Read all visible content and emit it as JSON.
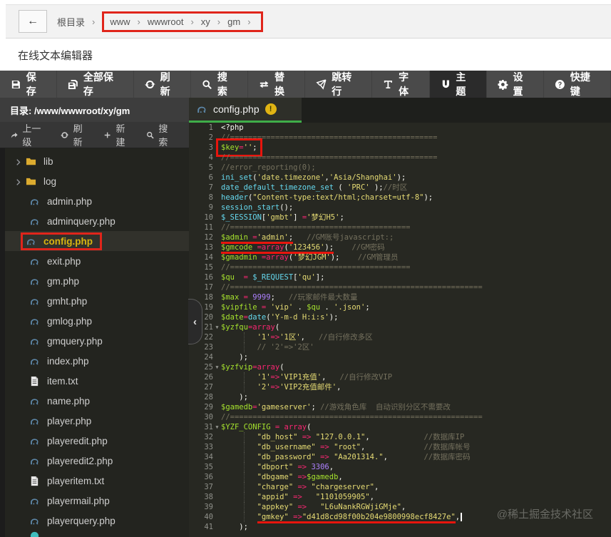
{
  "breadcrumb": {
    "back_glyph": "←",
    "root": "根目录",
    "separator": "›",
    "path": [
      "www",
      "wwwroot",
      "xy",
      "gm"
    ]
  },
  "page": {
    "title": "在线文本编辑器"
  },
  "toolbar": {
    "buttons": [
      {
        "name": "save",
        "icon": "save-icon",
        "label": "保存"
      },
      {
        "name": "save-all",
        "icon": "save-all-icon",
        "label": "全部保存"
      },
      {
        "name": "refresh",
        "icon": "refresh-icon",
        "label": "刷新"
      },
      {
        "name": "search",
        "icon": "search-icon",
        "label": "搜索"
      },
      {
        "name": "replace",
        "icon": "replace-icon",
        "label": "替换"
      },
      {
        "name": "goto-line",
        "icon": "goto-line-icon",
        "label": "跳转行"
      },
      {
        "name": "font",
        "icon": "font-icon",
        "label": "字体"
      },
      {
        "name": "theme",
        "icon": "theme-icon",
        "label": "主题",
        "active": true
      },
      {
        "name": "settings",
        "icon": "gear-icon",
        "label": "设置"
      },
      {
        "name": "hotkeys",
        "icon": "question-icon",
        "label": "快捷键"
      }
    ]
  },
  "sidebar": {
    "dir_label": "目录: /www/wwwroot/xy/gm",
    "actions": [
      {
        "name": "up-level",
        "icon": "up-icon",
        "label": "上一级"
      },
      {
        "name": "refresh",
        "icon": "refresh-icon",
        "label": "刷新"
      },
      {
        "name": "new-file",
        "icon": "plus-icon",
        "label": "新建"
      },
      {
        "name": "search",
        "icon": "search-icon",
        "label": "搜索"
      }
    ],
    "collapse_glyph": "‹",
    "tree": [
      {
        "type": "folder",
        "name": "lib"
      },
      {
        "type": "folder",
        "name": "log"
      },
      {
        "type": "php",
        "name": "admin.php"
      },
      {
        "type": "php",
        "name": "adminquery.php"
      },
      {
        "type": "php",
        "name": "config.php",
        "selected": true,
        "annotated": true
      },
      {
        "type": "php",
        "name": "exit.php"
      },
      {
        "type": "php",
        "name": "gm.php"
      },
      {
        "type": "php",
        "name": "gmht.php"
      },
      {
        "type": "php",
        "name": "gmlog.php"
      },
      {
        "type": "php",
        "name": "gmquery.php"
      },
      {
        "type": "php",
        "name": "index.php"
      },
      {
        "type": "txt",
        "name": "item.txt"
      },
      {
        "type": "php",
        "name": "name.php"
      },
      {
        "type": "php",
        "name": "player.php"
      },
      {
        "type": "php",
        "name": "playeredit.php"
      },
      {
        "type": "php",
        "name": "playeredit2.php"
      },
      {
        "type": "txt",
        "name": "playeritem.txt"
      },
      {
        "type": "php",
        "name": "playermail.php"
      },
      {
        "type": "php",
        "name": "playerquery.php"
      },
      {
        "type": "partial",
        "name": ""
      }
    ]
  },
  "editor": {
    "tab": {
      "icon": "php-icon",
      "label": "config.php",
      "warning_glyph": "!"
    },
    "lines": [
      {
        "tokens": [
          [
            "pl",
            "<?php"
          ]
        ]
      },
      {
        "tokens": [
          [
            "cm",
            "//=============================================="
          ]
        ]
      },
      {
        "box": [
          0,
          3
        ],
        "tokens": [
          [
            "var",
            "$key"
          ],
          [
            "kw",
            "="
          ],
          [
            "st",
            "''"
          ],
          [
            "pl",
            ";"
          ]
        ]
      },
      {
        "tokens": [
          [
            "cm",
            "//=============================================="
          ]
        ]
      },
      {
        "tokens": [
          [
            "cm",
            "//error_reporting(0);"
          ]
        ]
      },
      {
        "tokens": [
          [
            "fn",
            "ini_set"
          ],
          [
            "pl",
            "("
          ],
          [
            "st",
            "'date.timezone'"
          ],
          [
            "pl",
            ","
          ],
          [
            "st",
            "'Asia/Shanghai'"
          ],
          [
            "pl",
            ");"
          ]
        ]
      },
      {
        "tokens": [
          [
            "fn",
            "date_default_timezone_set"
          ],
          [
            "pl",
            " ( "
          ],
          [
            "st",
            "'PRC'"
          ],
          [
            "pl",
            " );"
          ],
          [
            "cm",
            "//时区"
          ]
        ]
      },
      {
        "tokens": [
          [
            "fn",
            "header"
          ],
          [
            "pl",
            "("
          ],
          [
            "st",
            "\"Content-type:text/html;charset=utf-8\""
          ],
          [
            "pl",
            ");"
          ]
        ]
      },
      {
        "tokens": [
          [
            "fn",
            "session_start"
          ],
          [
            "pl",
            "();"
          ]
        ]
      },
      {
        "tokens": [
          [
            "fn",
            "$_SESSION"
          ],
          [
            "pl",
            "["
          ],
          [
            "st",
            "'gmbt'"
          ],
          [
            "pl",
            "] "
          ],
          [
            "kw",
            "="
          ],
          [
            "st",
            "'梦幻H5'"
          ],
          [
            "pl",
            ";"
          ]
        ]
      },
      {
        "tokens": [
          [
            "cm",
            "//========================================"
          ]
        ]
      },
      {
        "ul": [
          0,
          3
        ],
        "tokens": [
          [
            "var",
            "$admin "
          ],
          [
            "kw",
            "="
          ],
          [
            "st",
            "'admin'"
          ],
          [
            "pl",
            ";"
          ],
          [
            "pl",
            "   "
          ],
          [
            "cm",
            "//GM账号javascript:;"
          ]
        ]
      },
      {
        "ul": [
          0,
          4
        ],
        "tokens": [
          [
            "var",
            "$gmcode "
          ],
          [
            "kw",
            "=array"
          ],
          [
            "pl",
            "("
          ],
          [
            "st",
            "'123456'"
          ],
          [
            "pl",
            ");"
          ],
          [
            "pl",
            "    "
          ],
          [
            "cm",
            "//GM密码"
          ]
        ]
      },
      {
        "tokens": [
          [
            "var",
            "$gmadmin "
          ],
          [
            "kw",
            "=array"
          ],
          [
            "pl",
            "("
          ],
          [
            "st",
            "'梦幻JGM'"
          ],
          [
            "pl",
            ");"
          ],
          [
            "pl",
            "    "
          ],
          [
            "cm",
            "//GM管理员"
          ]
        ]
      },
      {
        "tokens": [
          [
            "cm",
            "//========================================"
          ]
        ]
      },
      {
        "tokens": [
          [
            "var",
            "$qu  "
          ],
          [
            "kw",
            "="
          ],
          [
            "pl",
            " "
          ],
          [
            "fn",
            "$_REQUEST"
          ],
          [
            "pl",
            "["
          ],
          [
            "st",
            "'qu'"
          ],
          [
            "pl",
            "];"
          ]
        ]
      },
      {
        "tokens": [
          [
            "cm",
            "//========================================================"
          ]
        ]
      },
      {
        "tokens": [
          [
            "var",
            "$max "
          ],
          [
            "kw",
            "="
          ],
          [
            "pl",
            " "
          ],
          [
            "num",
            "9999"
          ],
          [
            "pl",
            ";"
          ],
          [
            "pl",
            "   "
          ],
          [
            "cm",
            "//玩家邮件最大数量"
          ]
        ]
      },
      {
        "tokens": [
          [
            "var",
            "$vipfile "
          ],
          [
            "kw",
            "="
          ],
          [
            "pl",
            " "
          ],
          [
            "st",
            "'vip'"
          ],
          [
            "pl",
            " . "
          ],
          [
            "var",
            "$qu"
          ],
          [
            "pl",
            " . "
          ],
          [
            "st",
            "'.json'"
          ],
          [
            "pl",
            ";"
          ]
        ]
      },
      {
        "tokens": [
          [
            "var",
            "$date"
          ],
          [
            "kw",
            "="
          ],
          [
            "fn",
            "date"
          ],
          [
            "pl",
            "("
          ],
          [
            "st",
            "'Y-m-d H:i:s'"
          ],
          [
            "pl",
            ");"
          ]
        ]
      },
      {
        "fold": true,
        "tokens": [
          [
            "var",
            "$yzfqu"
          ],
          [
            "kw",
            "=array"
          ],
          [
            "pl",
            "("
          ]
        ]
      },
      {
        "guide": true,
        "tokens": [
          [
            "pl",
            "        "
          ],
          [
            "st",
            "'1'"
          ],
          [
            "kw",
            "=>"
          ],
          [
            "st",
            "'1区'"
          ],
          [
            "pl",
            ","
          ],
          [
            "pl",
            "   "
          ],
          [
            "cm",
            "//自行修改多区"
          ]
        ]
      },
      {
        "guide": true,
        "tokens": [
          [
            "pl",
            "        "
          ],
          [
            "cm",
            "// '2'=>'2区'"
          ]
        ]
      },
      {
        "tokens": [
          [
            "pl",
            "    );"
          ]
        ]
      },
      {
        "fold": true,
        "tokens": [
          [
            "var",
            "$yzfvip"
          ],
          [
            "kw",
            "=array"
          ],
          [
            "pl",
            "("
          ]
        ]
      },
      {
        "guide": true,
        "tokens": [
          [
            "pl",
            "        "
          ],
          [
            "st",
            "'1'"
          ],
          [
            "kw",
            "=>"
          ],
          [
            "st",
            "'VIP1充值'"
          ],
          [
            "pl",
            ","
          ],
          [
            "pl",
            "   "
          ],
          [
            "cm",
            "//自行修改VIP"
          ]
        ]
      },
      {
        "guide": true,
        "tokens": [
          [
            "pl",
            "        "
          ],
          [
            "st",
            "'2'"
          ],
          [
            "kw",
            "=>"
          ],
          [
            "st",
            "'VIP2充值邮件'"
          ],
          [
            "pl",
            ","
          ]
        ]
      },
      {
        "tokens": [
          [
            "pl",
            "    );"
          ]
        ]
      },
      {
        "tokens": [
          [
            "var",
            "$gamedb"
          ],
          [
            "kw",
            "="
          ],
          [
            "st",
            "'gameserver'"
          ],
          [
            "pl",
            "; "
          ],
          [
            "cm",
            "//游戏角色库  自动识别分区不需要改"
          ]
        ]
      },
      {
        "tokens": [
          [
            "cm",
            "//========================================================"
          ]
        ]
      },
      {
        "fold": true,
        "tokens": [
          [
            "var",
            "$YZF_CONFIG "
          ],
          [
            "kw",
            "="
          ],
          [
            "pl",
            " "
          ],
          [
            "kw",
            "array"
          ],
          [
            "pl",
            "("
          ]
        ]
      },
      {
        "guide": true,
        "tokens": [
          [
            "pl",
            "        "
          ],
          [
            "st",
            "\"db_host\""
          ],
          [
            "pl",
            " "
          ],
          [
            "kw",
            "=>"
          ],
          [
            "pl",
            " "
          ],
          [
            "st",
            "\"127.0.0.1\""
          ],
          [
            "pl",
            ","
          ],
          [
            "pl",
            "            "
          ],
          [
            "cm",
            "//数据库IP"
          ]
        ]
      },
      {
        "guide": true,
        "tokens": [
          [
            "pl",
            "        "
          ],
          [
            "st",
            "\"db_username\""
          ],
          [
            "pl",
            " "
          ],
          [
            "kw",
            "=>"
          ],
          [
            "pl",
            " "
          ],
          [
            "st",
            "\"root\""
          ],
          [
            "pl",
            ","
          ],
          [
            "pl",
            "             "
          ],
          [
            "cm",
            "//数据库帐号"
          ]
        ]
      },
      {
        "guide": true,
        "tokens": [
          [
            "pl",
            "        "
          ],
          [
            "st",
            "\"db_password\""
          ],
          [
            "pl",
            " "
          ],
          [
            "kw",
            "=>"
          ],
          [
            "pl",
            " "
          ],
          [
            "st",
            "\"Aa201314.\""
          ],
          [
            "pl",
            ","
          ],
          [
            "pl",
            "        "
          ],
          [
            "cm",
            "//数据库密码"
          ]
        ]
      },
      {
        "guide": true,
        "tokens": [
          [
            "pl",
            "        "
          ],
          [
            "st",
            "\"dbport\""
          ],
          [
            "pl",
            " "
          ],
          [
            "kw",
            "=>"
          ],
          [
            "pl",
            " "
          ],
          [
            "num",
            "3306"
          ],
          [
            "pl",
            ","
          ]
        ]
      },
      {
        "guide": true,
        "tokens": [
          [
            "pl",
            "        "
          ],
          [
            "st",
            "\"dbgame\""
          ],
          [
            "pl",
            " "
          ],
          [
            "kw",
            "=>"
          ],
          [
            "var",
            "$gamedb"
          ],
          [
            "pl",
            ","
          ]
        ]
      },
      {
        "guide": true,
        "tokens": [
          [
            "pl",
            "        "
          ],
          [
            "st",
            "\"charge\""
          ],
          [
            "pl",
            " "
          ],
          [
            "kw",
            "=>"
          ],
          [
            "pl",
            " "
          ],
          [
            "st",
            "\"chargeserver\""
          ],
          [
            "pl",
            ","
          ]
        ]
      },
      {
        "guide": true,
        "tokens": [
          [
            "pl",
            "        "
          ],
          [
            "st",
            "\"appid\""
          ],
          [
            "pl",
            " "
          ],
          [
            "kw",
            "=>"
          ],
          [
            "pl",
            "   "
          ],
          [
            "st",
            "\"1101059905\""
          ],
          [
            "pl",
            ","
          ]
        ]
      },
      {
        "guide": true,
        "tokens": [
          [
            "pl",
            "        "
          ],
          [
            "st",
            "\"appkey\""
          ],
          [
            "pl",
            " "
          ],
          [
            "kw",
            "=>"
          ],
          [
            "pl",
            "   "
          ],
          [
            "st",
            "\"L6uNankRGWjiGMje\""
          ],
          [
            "pl",
            ","
          ]
        ]
      },
      {
        "guide": true,
        "ul": [
          1,
          4
        ],
        "cursor": true,
        "tokens": [
          [
            "pl",
            "        "
          ],
          [
            "st",
            "\"gmkey\""
          ],
          [
            "pl",
            " "
          ],
          [
            "kw",
            "=>"
          ],
          [
            "st",
            "\"d41d8cd98f00b204e9800998ecf8427e\""
          ],
          [
            "pl",
            ","
          ]
        ]
      },
      {
        "tokens": [
          [
            "pl",
            "    );"
          ]
        ]
      }
    ]
  },
  "watermark": "@稀土掘金技术社区",
  "colors": {
    "annotation_red": "#e0251b",
    "tab_underline_green": "#3fae49",
    "selected_file_yellow": "#d8b511",
    "warning_badge_yellow": "#e0b413",
    "toolbar_bg": "#4a4a4a",
    "editor_bg": "#272822"
  }
}
